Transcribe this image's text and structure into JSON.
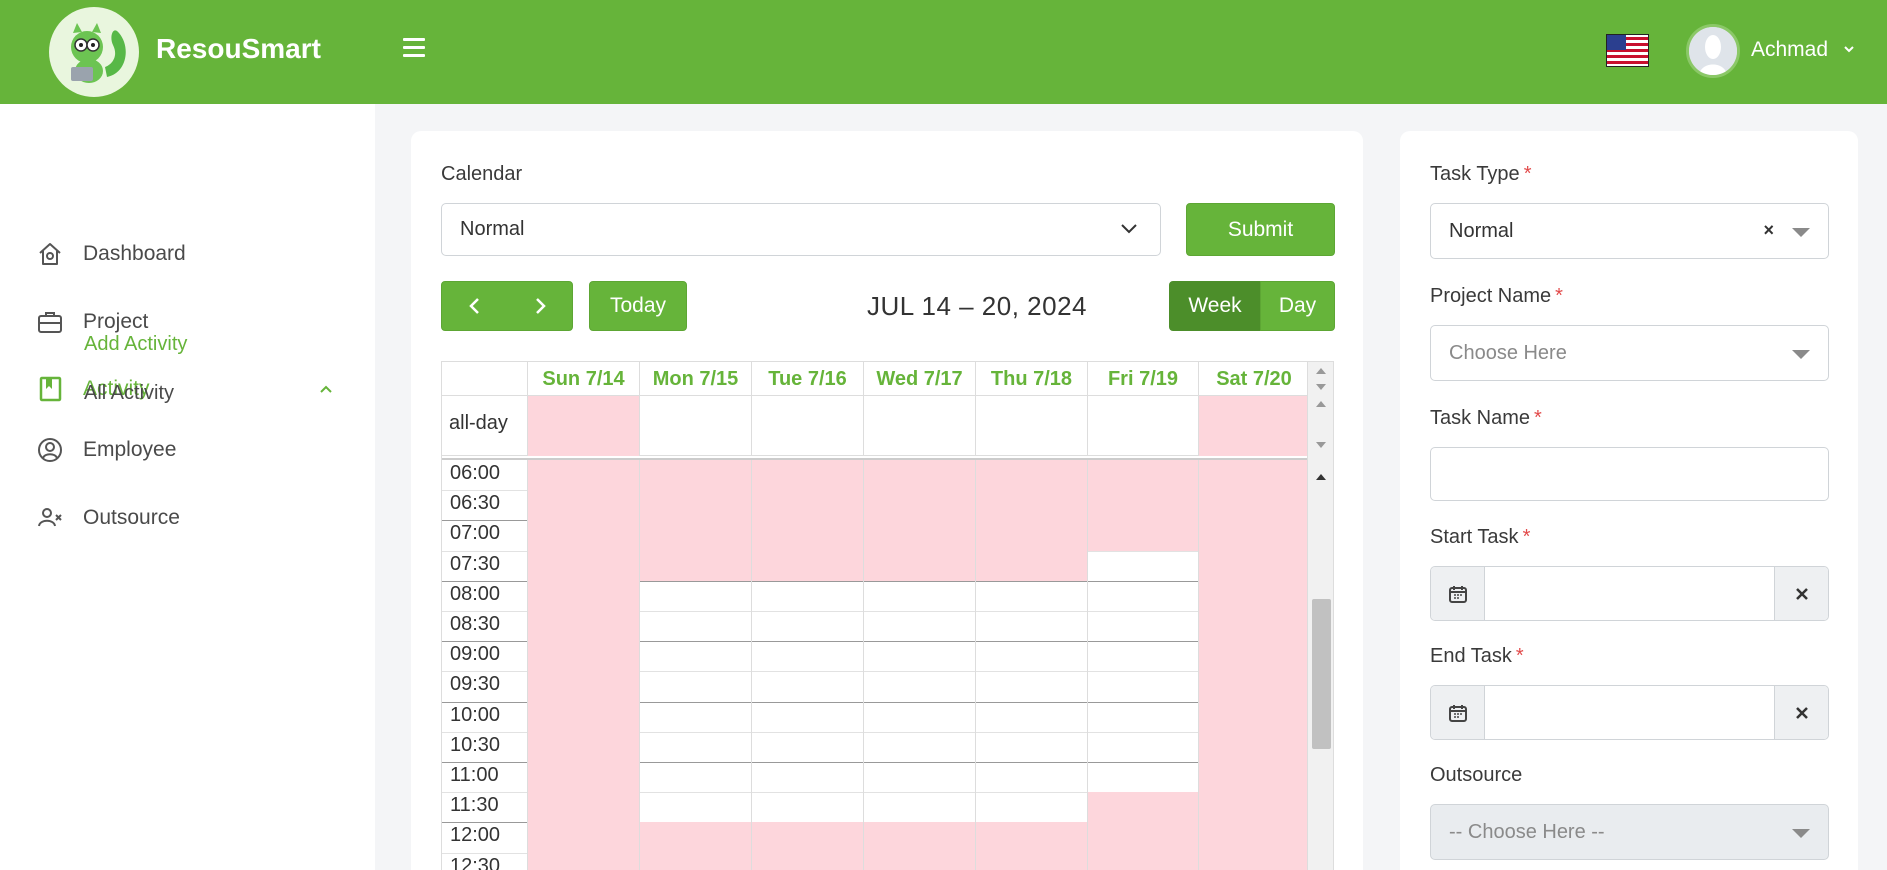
{
  "header": {
    "brand": "ResouSmart",
    "username": "Achmad"
  },
  "sidebar": {
    "items": [
      {
        "label": "Dashboard"
      },
      {
        "label": "Project"
      },
      {
        "label": "Activity"
      },
      {
        "label": "Employee"
      },
      {
        "label": "Outsource"
      }
    ],
    "sub_items": [
      {
        "label": "Add Activity"
      },
      {
        "label": "All Activity"
      }
    ]
  },
  "calendar_panel": {
    "label": "Calendar",
    "select_value": "Normal",
    "submit_label": "Submit",
    "today_label": "Today",
    "date_range": "JUL 14 – 20, 2024",
    "week_label": "Week",
    "day_label": "Day",
    "allday_label": "all-day",
    "days": [
      "Sun 7/14",
      "Mon 7/15",
      "Tue 7/16",
      "Wed 7/17",
      "Thu 7/18",
      "Fri 7/19",
      "Sat 7/20"
    ],
    "times": [
      "06:00",
      "06:30",
      "07:00",
      "07:30",
      "08:00",
      "08:30",
      "09:00",
      "09:30",
      "10:00",
      "10:30",
      "11:00",
      "11:30",
      "12:00",
      "12:30"
    ]
  },
  "form": {
    "task_type_label": "Task Type",
    "task_type_value": "Normal",
    "project_name_label": "Project Name",
    "project_name_placeholder": "Choose Here",
    "task_name_label": "Task Name",
    "start_task_label": "Start Task",
    "end_task_label": "End Task",
    "outsource_label": "Outsource",
    "outsource_placeholder": "-- Choose Here --",
    "required_mark": "*"
  },
  "colors": {
    "brand_green": "#66b43a",
    "unavailable_pink": "#fdd6dc"
  }
}
